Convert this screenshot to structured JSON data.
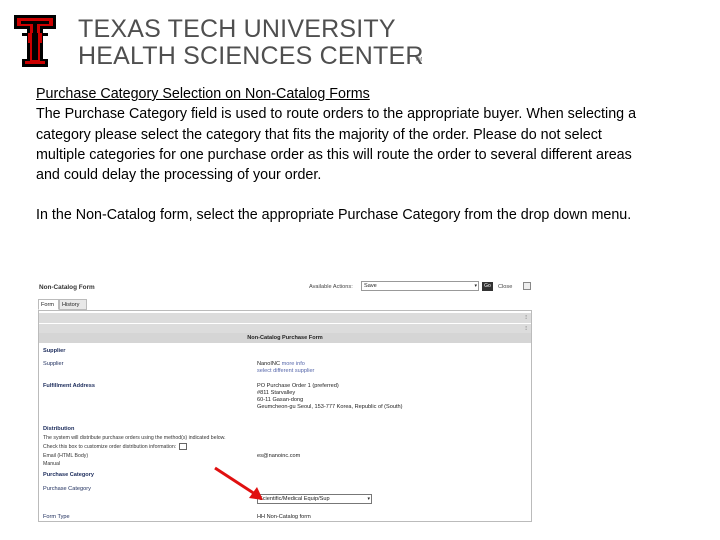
{
  "header": {
    "university_line1": "TEXAS TECH UNIVERSITY",
    "university_line2": "HEALTH SCIENCES CENTER",
    "trademark": "TM"
  },
  "document": {
    "heading": "Purchase Category Selection on Non-Catalog Forms",
    "paragraph1": "The Purchase Category field is used to route orders to the appropriate buyer.  When selecting a category please select the category that fits the majority of the order.  Please do not select multiple categories for one purchase order as this will route the order to several different areas and could delay the processing of your order.",
    "paragraph2": "In the Non-Catalog form, select the appropriate Purchase Category from the drop down menu."
  },
  "screenshot": {
    "form_title": "Non-Catalog Form",
    "available_actions_label": "Available Actions:",
    "available_actions_value": "Save",
    "go_label": "Go",
    "close_label": "Close",
    "tabs": [
      "Form",
      "History"
    ],
    "form_header": "Non-Catalog Purchase Form",
    "supplier_section": "Supplier",
    "supplier_label": "Supplier",
    "supplier_value": "NanoINC",
    "supplier_more_info": "more info",
    "select_different_supplier": "select different supplier",
    "fulfillment_label": "Fulfillment Address",
    "address_line1": "PO Purchase Order 1 (preferred)",
    "address_line2": "#811 Starvalley",
    "address_line3": "60-11 Gasan-dong",
    "address_line4": "Geumcheon-gu  Seoul, 153-777 Korea, Republic of (South)",
    "distribution_section": "Distribution",
    "distribution_note": "The system will distribute purchase orders using the method(s) indicated below.",
    "distribution_checkbox_text": "Check this box to customize order distribution information:",
    "email_label": "Email (HTML Body)",
    "email_value": "es@nanoinc.com",
    "manual_label": "Manual",
    "purchase_category_section": "Purchase Category",
    "purchase_category_label": "Purchase Category",
    "purchase_category_value": "Scientific/Medical Equip/Sup",
    "form_type_label": "Form Type",
    "form_type_value": "HH  Non-Catalog form",
    "colors": {
      "arrow": "#e01010",
      "label_text": "#1a2a5a",
      "logo_red": "#cc0000"
    }
  }
}
